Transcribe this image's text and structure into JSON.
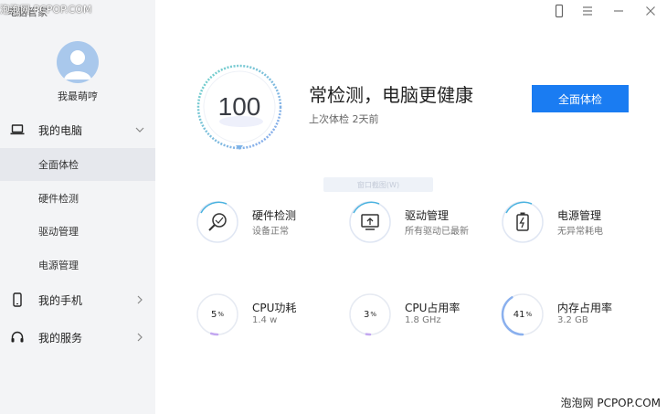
{
  "app": {
    "title": "电脑管家"
  },
  "user": {
    "name": "我最萌哼"
  },
  "sidebar": {
    "groups": [
      {
        "label": "我的电脑",
        "icon": "laptop-icon",
        "expanded": true
      },
      {
        "label": "我的手机",
        "icon": "phone-icon",
        "expanded": false
      },
      {
        "label": "我的服务",
        "icon": "headset-icon",
        "expanded": false
      }
    ],
    "items": [
      {
        "label": "全面体检",
        "active": true
      },
      {
        "label": "硬件检测",
        "active": false
      },
      {
        "label": "驱动管理",
        "active": false
      },
      {
        "label": "电源管理",
        "active": false
      }
    ]
  },
  "titlebar": {
    "buttons": [
      "phone-icon",
      "menu-icon",
      "minimize-icon",
      "close-icon"
    ]
  },
  "hero": {
    "score": "100",
    "headline": "常检测，电脑更健康",
    "last_check": "上次体检 2天前",
    "button_label": "全面体检",
    "overlay_text": "窗口截图(W)"
  },
  "features": [
    {
      "title": "硬件检测",
      "subtitle": "设备正常",
      "icon": "hardware-check-icon"
    },
    {
      "title": "驱动管理",
      "subtitle": "所有驱动已最新",
      "icon": "driver-icon"
    },
    {
      "title": "电源管理",
      "subtitle": "无异常耗电",
      "icon": "power-icon"
    }
  ],
  "metrics": [
    {
      "title": "CPU功耗",
      "value": "5",
      "unit": "%",
      "detail": "1.4 w",
      "fraction": 0.05
    },
    {
      "title": "CPU占用率",
      "value": "3",
      "unit": "%",
      "detail": "1.8 GHz",
      "fraction": 0.03
    },
    {
      "title": "内存占用率",
      "value": "41",
      "unit": "%",
      "detail": "3.2 GB",
      "fraction": 0.41
    }
  ],
  "watermarks": {
    "top": "泡泡网 PCPOP.COM",
    "bottom": "泡泡网 PCPOP.COM"
  },
  "colors": {
    "accent": "#1a7cf2",
    "sidebar_bg": "#f3f4f6",
    "active_item_bg": "#e6e8ed",
    "ring_gradient_start": "#6fd3c8",
    "ring_gradient_end": "#8aa8f0"
  }
}
